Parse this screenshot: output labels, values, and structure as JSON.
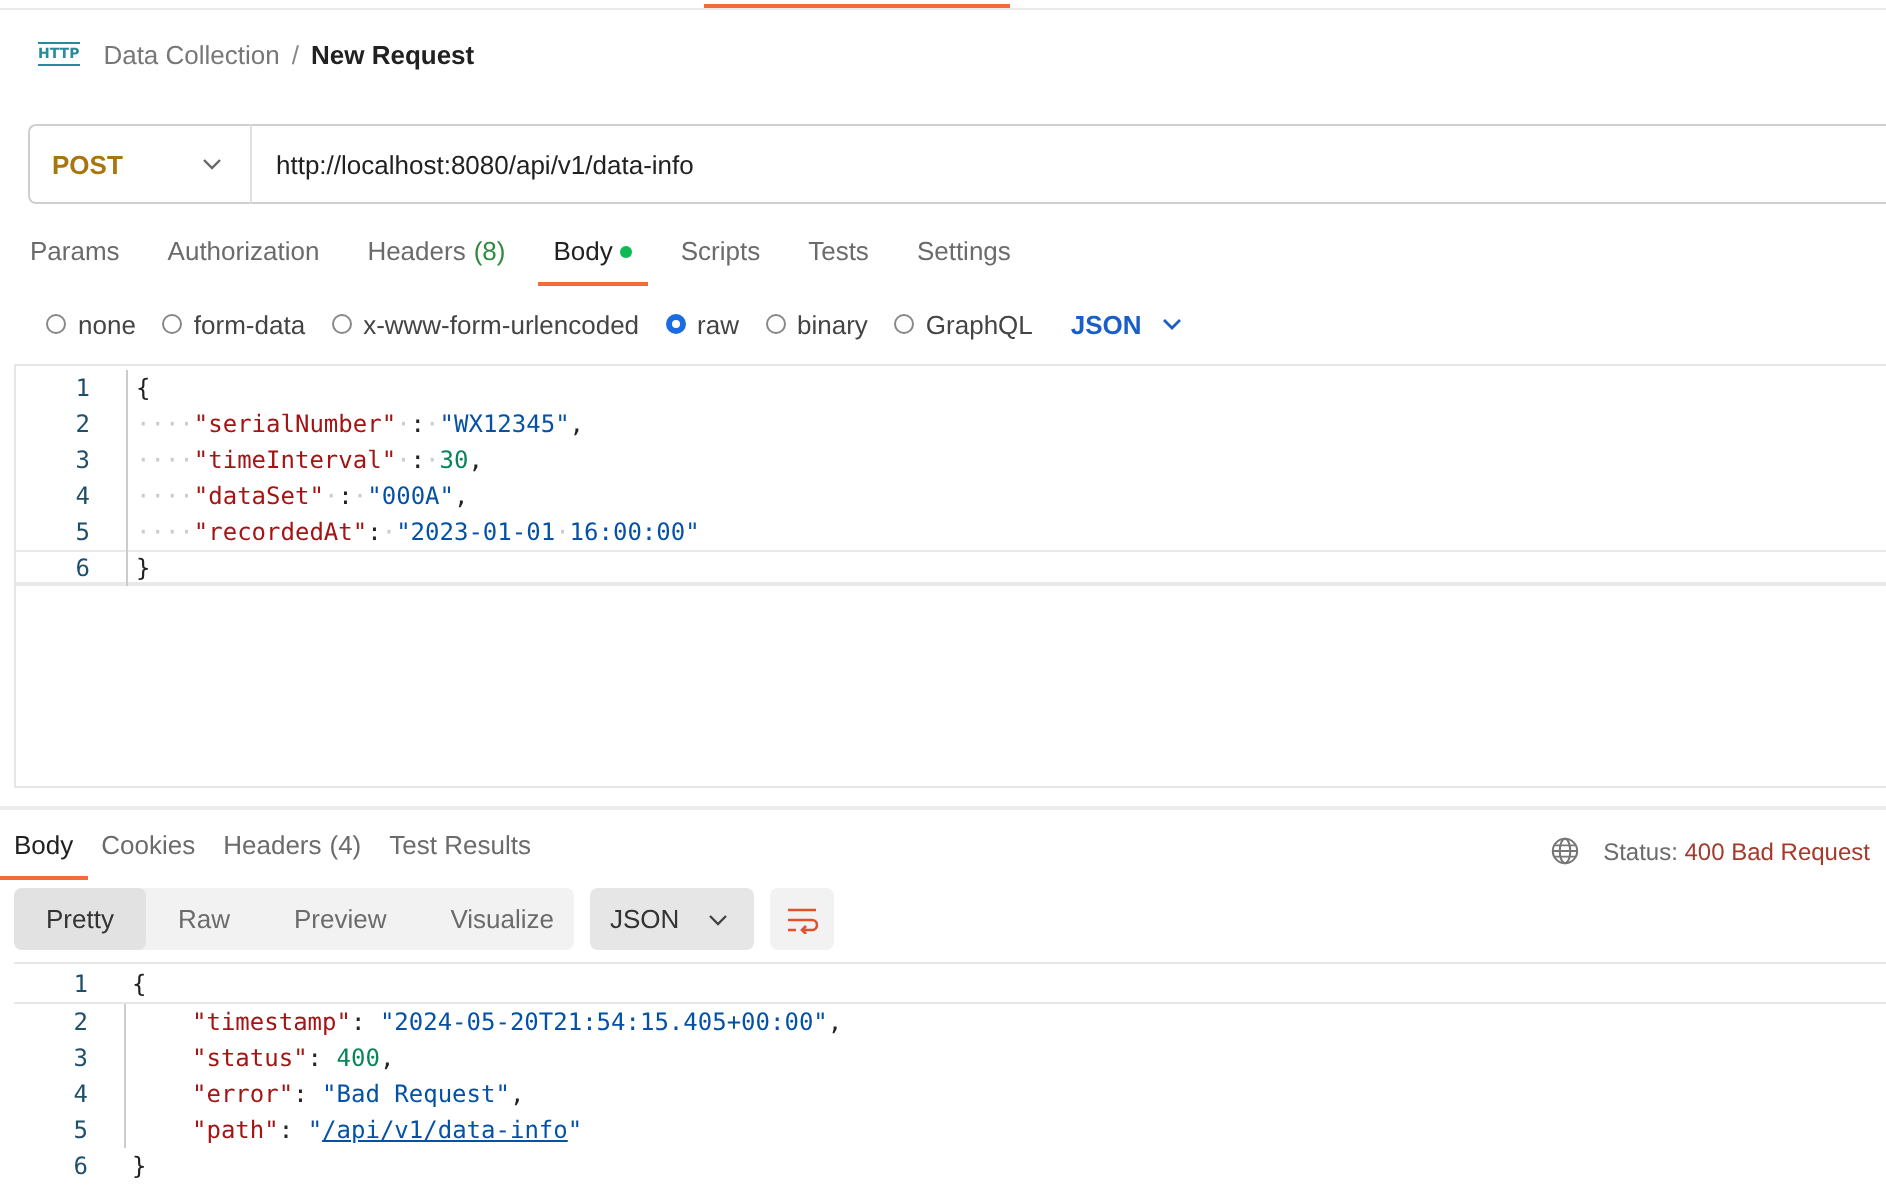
{
  "breadcrumb": {
    "icon_text": "HTTP",
    "collection": "Data Collection",
    "separator": "/",
    "request": "New Request"
  },
  "request": {
    "method": "POST",
    "url": "http://localhost:8080/api/v1/data-info"
  },
  "request_tabs": [
    {
      "label": "Params",
      "selected": false
    },
    {
      "label": "Authorization",
      "selected": false
    },
    {
      "label": "Headers",
      "count": "(8)",
      "selected": false
    },
    {
      "label": "Body",
      "selected": true,
      "dot": true
    },
    {
      "label": "Scripts",
      "selected": false
    },
    {
      "label": "Tests",
      "selected": false
    },
    {
      "label": "Settings",
      "selected": false
    }
  ],
  "body_types": [
    {
      "label": "none",
      "selected": false
    },
    {
      "label": "form-data",
      "selected": false
    },
    {
      "label": "x-www-form-urlencoded",
      "selected": false
    },
    {
      "label": "raw",
      "selected": true
    },
    {
      "label": "binary",
      "selected": false
    },
    {
      "label": "GraphQL",
      "selected": false
    }
  ],
  "body_format": "JSON",
  "request_body": [
    {
      "number": "1",
      "tokens": [
        {
          "kind": "punct",
          "text": "{"
        }
      ]
    },
    {
      "number": "2",
      "tokens": [
        {
          "kind": "ws",
          "text": "····"
        },
        {
          "kind": "key",
          "text": "\"serialNumber\""
        },
        {
          "kind": "ws",
          "text": "·"
        },
        {
          "kind": "punct",
          "text": ":"
        },
        {
          "kind": "ws",
          "text": "·"
        },
        {
          "kind": "string",
          "text": "\"WX12345\""
        },
        {
          "kind": "punct",
          "text": ","
        }
      ]
    },
    {
      "number": "3",
      "tokens": [
        {
          "kind": "ws",
          "text": "····"
        },
        {
          "kind": "key",
          "text": "\"timeInterval\""
        },
        {
          "kind": "ws",
          "text": "·"
        },
        {
          "kind": "punct",
          "text": ":"
        },
        {
          "kind": "ws",
          "text": "·"
        },
        {
          "kind": "number",
          "text": "30"
        },
        {
          "kind": "punct",
          "text": ","
        }
      ]
    },
    {
      "number": "4",
      "tokens": [
        {
          "kind": "ws",
          "text": "····"
        },
        {
          "kind": "key",
          "text": "\"dataSet\""
        },
        {
          "kind": "ws",
          "text": "·"
        },
        {
          "kind": "punct",
          "text": ":"
        },
        {
          "kind": "ws",
          "text": "·"
        },
        {
          "kind": "string",
          "text": "\"000A\""
        },
        {
          "kind": "punct",
          "text": ","
        }
      ]
    },
    {
      "number": "5",
      "tokens": [
        {
          "kind": "ws",
          "text": "····"
        },
        {
          "kind": "key",
          "text": "\"recordedAt\""
        },
        {
          "kind": "punct",
          "text": ":"
        },
        {
          "kind": "ws",
          "text": "·"
        },
        {
          "kind": "string",
          "text": "\"2023-01-01"
        },
        {
          "kind": "ws",
          "text": "·"
        },
        {
          "kind": "string",
          "text": "16:00:00\""
        }
      ]
    },
    {
      "number": "6",
      "tokens": [
        {
          "kind": "punct",
          "text": "}"
        }
      ]
    }
  ],
  "response_tabs": [
    {
      "label": "Body",
      "selected": true
    },
    {
      "label": "Cookies",
      "selected": false
    },
    {
      "label": "Headers",
      "count": "(4)",
      "selected": false
    },
    {
      "label": "Test Results",
      "selected": false
    }
  ],
  "status": {
    "label": "Status:",
    "value": "400 Bad Request"
  },
  "view_modes": [
    {
      "label": "Pretty",
      "selected": true
    },
    {
      "label": "Raw",
      "selected": false
    },
    {
      "label": "Preview",
      "selected": false
    },
    {
      "label": "Visualize",
      "selected": false
    }
  ],
  "response_format": "JSON",
  "response_body": [
    {
      "number": "1",
      "tokens": [
        {
          "kind": "punct",
          "text": "{"
        }
      ]
    },
    {
      "number": "2",
      "indented": true,
      "tokens": [
        {
          "kind": "key",
          "text": "\"timestamp\""
        },
        {
          "kind": "punct",
          "text": ": "
        },
        {
          "kind": "string",
          "text": "\"2024-05-20T21:54:15.405+00:00\""
        },
        {
          "kind": "punct",
          "text": ","
        }
      ]
    },
    {
      "number": "3",
      "indented": true,
      "tokens": [
        {
          "kind": "key",
          "text": "\"status\""
        },
        {
          "kind": "punct",
          "text": ": "
        },
        {
          "kind": "number",
          "text": "400"
        },
        {
          "kind": "punct",
          "text": ","
        }
      ]
    },
    {
      "number": "4",
      "indented": true,
      "tokens": [
        {
          "kind": "key",
          "text": "\"error\""
        },
        {
          "kind": "punct",
          "text": ": "
        },
        {
          "kind": "string",
          "text": "\"Bad Request\""
        },
        {
          "kind": "punct",
          "text": ","
        }
      ]
    },
    {
      "number": "5",
      "indented": true,
      "tokens": [
        {
          "kind": "key",
          "text": "\"path\""
        },
        {
          "kind": "punct",
          "text": ": "
        },
        {
          "kind": "string",
          "text": "\""
        },
        {
          "kind": "link",
          "text": "/api/v1/data-info"
        },
        {
          "kind": "string",
          "text": "\""
        }
      ]
    },
    {
      "number": "6",
      "tokens": [
        {
          "kind": "punct",
          "text": "}"
        }
      ]
    }
  ]
}
